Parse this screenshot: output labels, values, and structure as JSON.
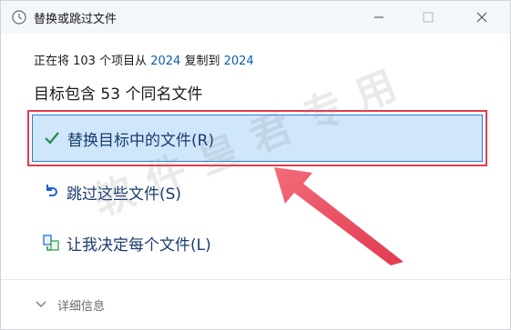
{
  "window": {
    "title": "替换或跳过文件",
    "icon": "clock-icon"
  },
  "status": {
    "prefix": "正在将 103 个项目从 ",
    "source": "2024",
    "middle": " 复制到 ",
    "destination": "2024"
  },
  "headline": "目标包含 53 个同名文件",
  "options": [
    {
      "label": "替换目标中的文件(R)",
      "icon": "checkmark-icon",
      "selected": true
    },
    {
      "label": "跳过这些文件(S)",
      "icon": "undo-icon",
      "selected": false
    },
    {
      "label": "让我决定每个文件(L)",
      "icon": "decide-icon",
      "selected": false
    }
  ],
  "footer": {
    "details_label": "详细信息",
    "icon": "chevron-down-icon"
  },
  "watermark": "软件皇君专用",
  "colors": {
    "accent": "#2f7bd6",
    "highlight": "#cfe6fb",
    "annotation": "#e23b4f",
    "link": "#0a5fa8"
  }
}
